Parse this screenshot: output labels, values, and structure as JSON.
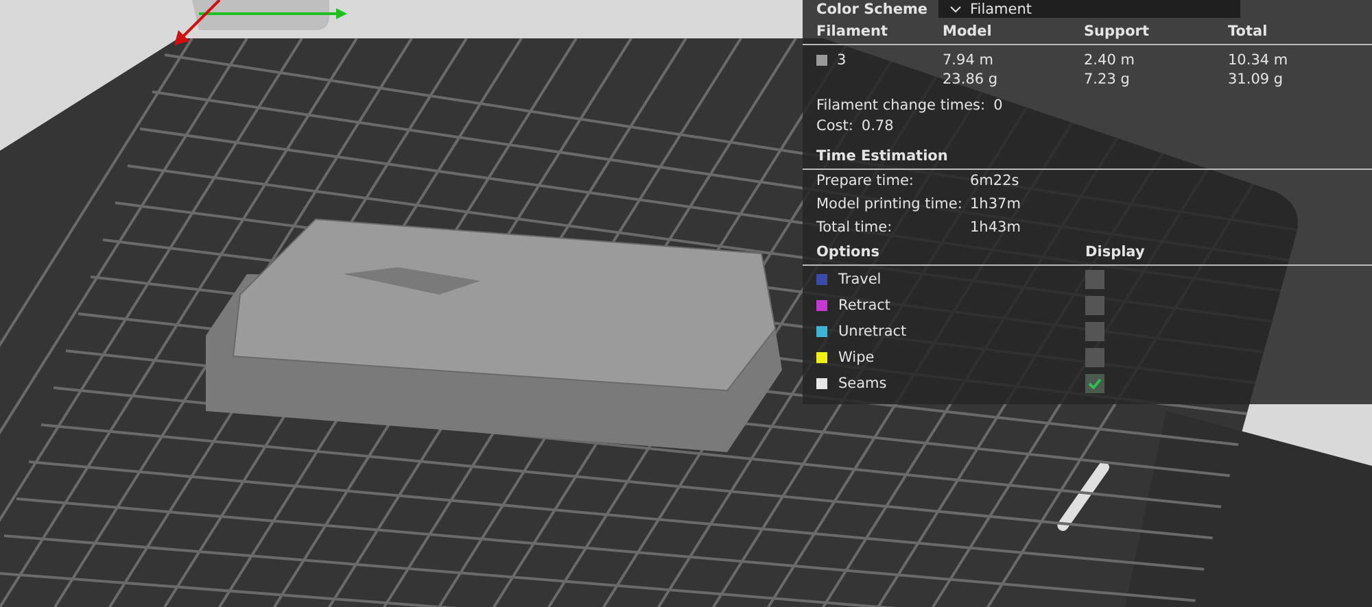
{
  "color_scheme": {
    "label": "Color Scheme",
    "value": "Filament"
  },
  "filament_table": {
    "columns": [
      "Filament",
      "Model",
      "Support",
      "Total"
    ],
    "rows": [
      {
        "color": "#9a9a9a",
        "filament": "3",
        "model": [
          "7.94 m",
          "23.86 g"
        ],
        "support": [
          "2.40 m",
          "7.23 g"
        ],
        "total": [
          "10.34 m",
          "31.09 g"
        ]
      }
    ]
  },
  "filament_change_times": {
    "label": "Filament change times:",
    "value": "0"
  },
  "cost": {
    "label": "Cost:",
    "value": "0.78"
  },
  "time_estimation": {
    "title": "Time Estimation",
    "rows": [
      {
        "label": "Prepare time:",
        "value": "6m22s"
      },
      {
        "label": "Model printing time:",
        "value": "1h37m"
      },
      {
        "label": "Total time:",
        "value": "1h43m"
      }
    ]
  },
  "options": {
    "columns": [
      "Options",
      "Display"
    ],
    "items": [
      {
        "label": "Travel",
        "color": "#3b4ba8",
        "checked": false
      },
      {
        "label": "Retract",
        "color": "#c43ad0",
        "checked": false
      },
      {
        "label": "Unretract",
        "color": "#3fb3d6",
        "checked": false
      },
      {
        "label": "Wipe",
        "color": "#f2ee18",
        "checked": false
      },
      {
        "label": "Seams",
        "color": "#e8e8e8",
        "checked": true
      }
    ]
  }
}
